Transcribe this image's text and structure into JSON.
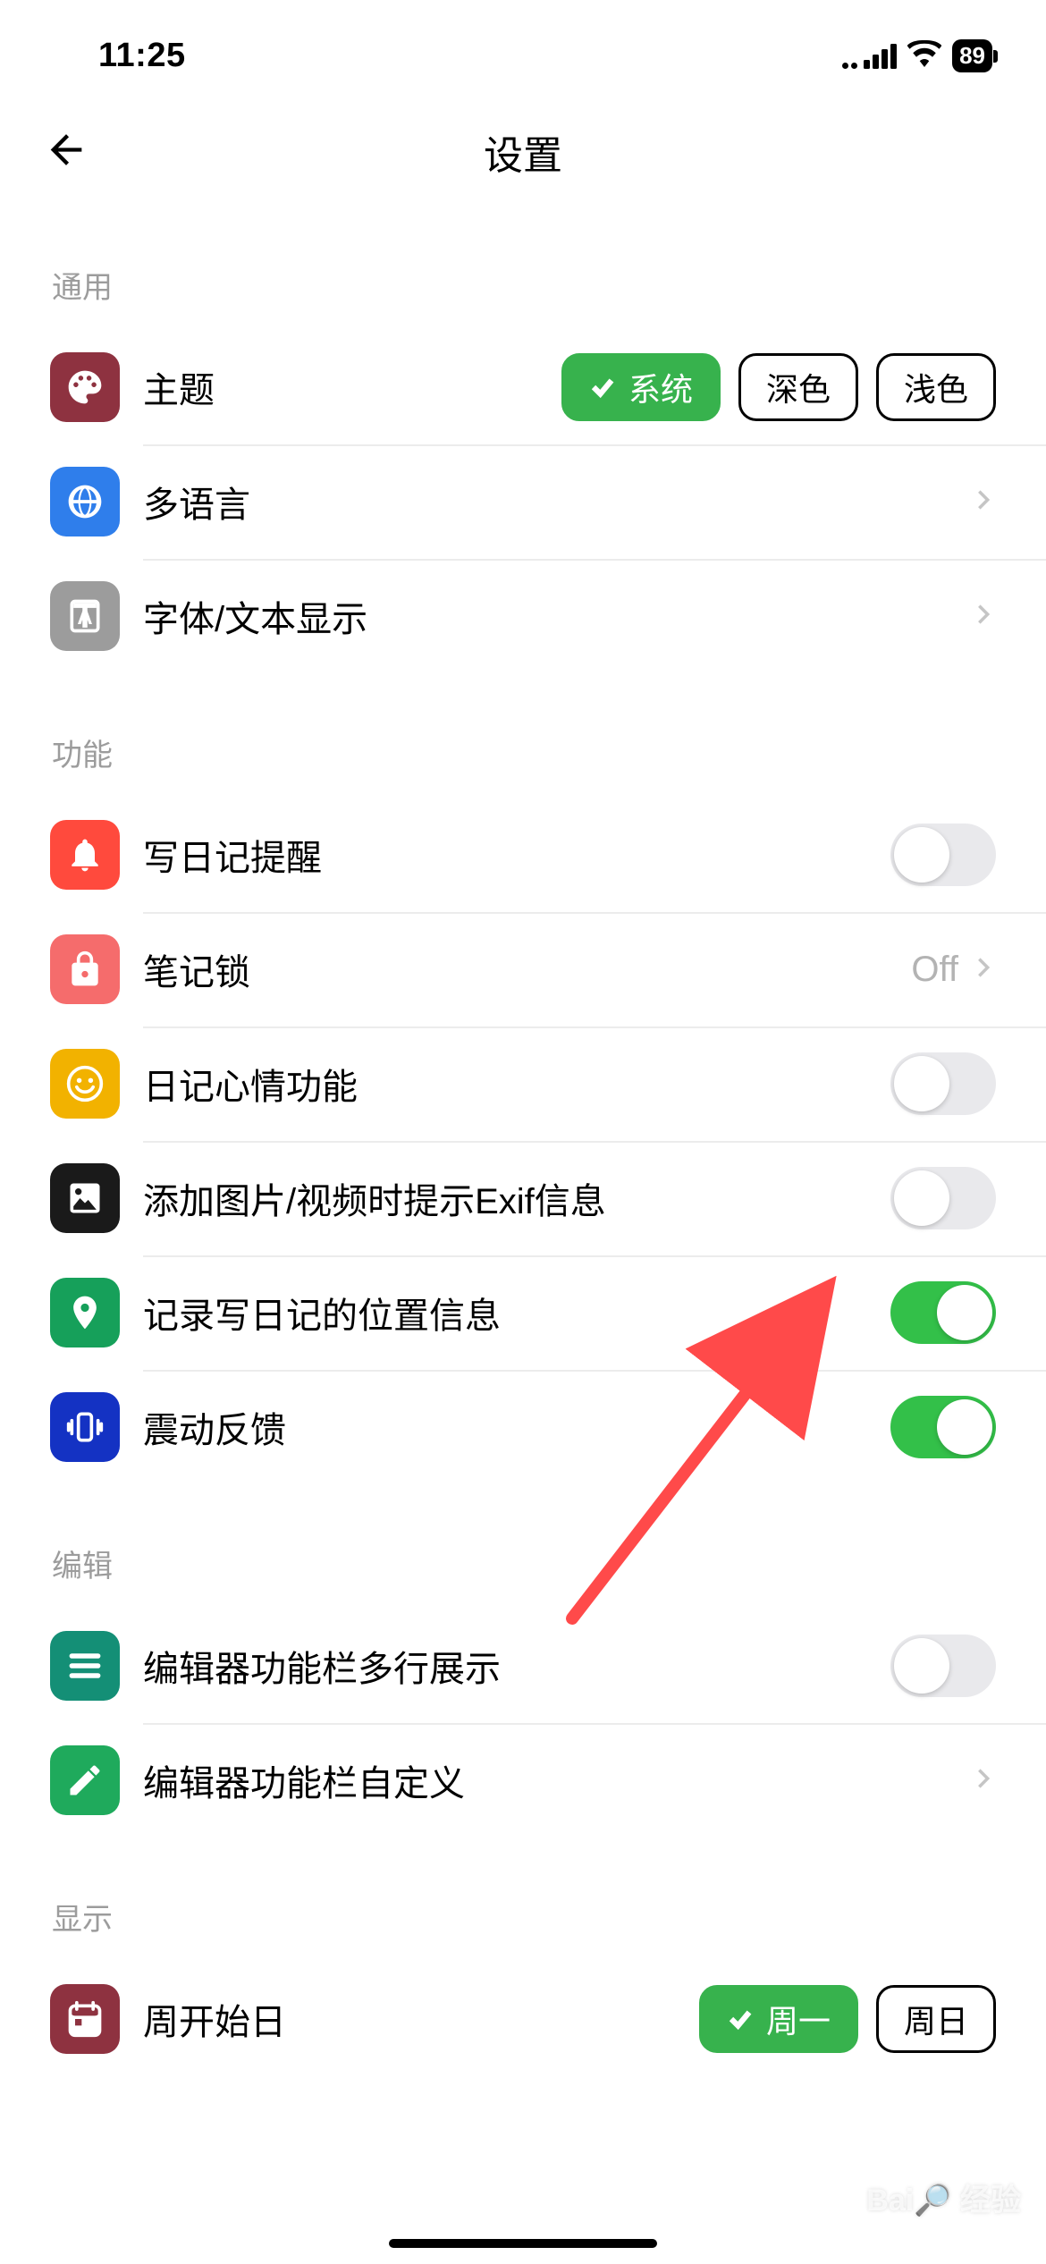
{
  "status": {
    "time": "11:25",
    "battery": "89"
  },
  "nav": {
    "title": "设置"
  },
  "sections": {
    "general": {
      "header": "通用",
      "theme": {
        "label": "主题",
        "options": [
          "系统",
          "深色",
          "浅色"
        ],
        "selected": "系统"
      },
      "language": {
        "label": "多语言"
      },
      "font": {
        "label": "字体/文本显示"
      }
    },
    "features": {
      "header": "功能",
      "reminder": {
        "label": "写日记提醒",
        "on": false
      },
      "lock": {
        "label": "笔记锁",
        "value": "Off"
      },
      "mood": {
        "label": "日记心情功能",
        "on": false
      },
      "exif": {
        "label": "添加图片/视频时提示Exif信息",
        "on": false
      },
      "location": {
        "label": "记录写日记的位置信息",
        "on": true
      },
      "vibration": {
        "label": "震动反馈",
        "on": true
      }
    },
    "edit": {
      "header": "编辑",
      "multiline": {
        "label": "编辑器功能栏多行展示",
        "on": false
      },
      "customize": {
        "label": "编辑器功能栏自定义"
      }
    },
    "display": {
      "header": "显示",
      "weekstart": {
        "label": "周开始日",
        "options": [
          "周一",
          "周日"
        ],
        "selected": "周一"
      }
    }
  },
  "watermark": {
    "brand": "Bai&#x1f50d; 经验",
    "sub": ""
  }
}
